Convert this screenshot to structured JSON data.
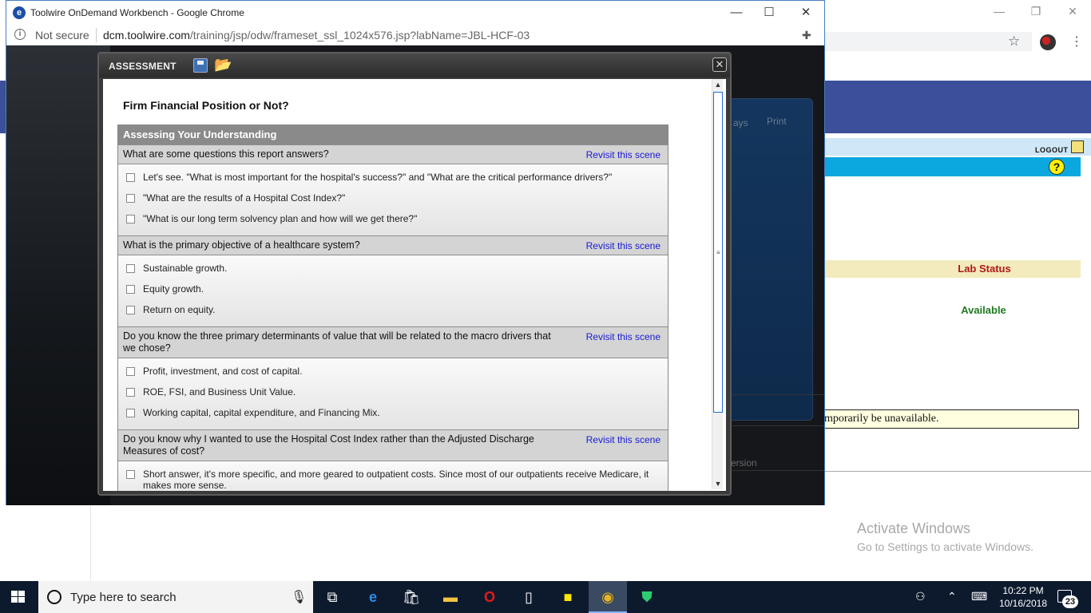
{
  "chrome": {
    "title": "Toolwire OnDemand Workbench - Google Chrome",
    "not_secure": "Not secure",
    "url_host": "dcm.toolwire.com",
    "url_path": "/training/jsp/odw/frameset_ssl_1024x576.jsp?labName=JBL-HCF-03"
  },
  "background_page": {
    "logout": "LOGOUT",
    "lab_status_label": "Lab Status",
    "lab_status_value": "Available",
    "notice_fragment": "mporarily be unavailable.",
    "behind_text_1": "ays",
    "behind_text_2": "Print",
    "behind_text_3": "ersion",
    "help_glyph": "?"
  },
  "dialog": {
    "title": "ASSESSMENT",
    "heading": "Firm Financial Position or Not?",
    "section_title": "Assessing Your Understanding",
    "revisit_label": "Revisit this scene",
    "questions": [
      {
        "text": "What are some questions this report answers?",
        "options": [
          "Let's see. \"What is most important for the hospital's success?\" and \"What are the critical performance drivers?\"",
          "\"What are the results of a Hospital Cost Index?\"",
          "\"What is our long term solvency plan and how will we get there?\""
        ]
      },
      {
        "text": "What is the primary objective of a healthcare system?",
        "options": [
          "Sustainable growth.",
          "Equity growth.",
          "Return on equity."
        ]
      },
      {
        "text": "Do you know the three primary determinants of value that will be related to the macro drivers that we chose?",
        "options": [
          "Profit, investment, and cost of capital.",
          "ROE, FSI, and Business Unit Value.",
          "Working capital, capital expenditure, and Financing Mix."
        ]
      },
      {
        "text": "Do you know why I wanted to use the Hospital Cost Index rather than the Adjusted Discharge Measures of cost?",
        "options": [
          "Short answer, it's more specific, and more geared to outpatient costs. Since most of our outpatients receive Medicare, it makes more sense."
        ]
      }
    ]
  },
  "watermark": {
    "line1": "Activate Windows",
    "line2": "Go to Settings to activate Windows."
  },
  "taskbar": {
    "search_placeholder": "Type here to search",
    "time": "10:22 PM",
    "date": "10/16/2018",
    "notification_count": "23"
  }
}
